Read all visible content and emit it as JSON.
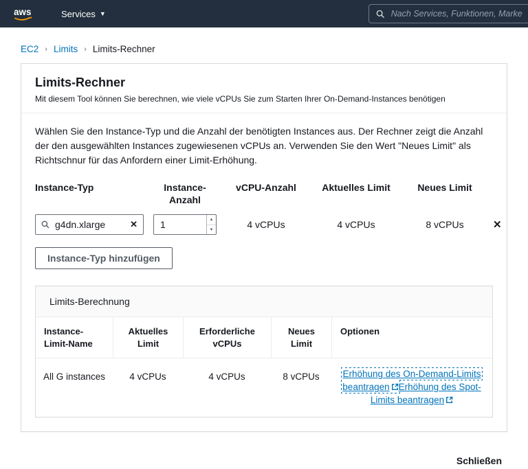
{
  "topbar": {
    "logo_text": "aws",
    "services_label": "Services",
    "search_placeholder": "Nach Services, Funktionen, Marketp"
  },
  "breadcrumb": {
    "items": [
      "EC2",
      "Limits",
      "Limits-Rechner"
    ],
    "separator": "›"
  },
  "card": {
    "title": "Limits-Rechner",
    "subtitle": "Mit diesem Tool können Sie berechnen, wie viele vCPUs Sie zum Starten Ihrer On-Demand-Instances benötigen",
    "description": "Wählen Sie den Instance-Typ und die Anzahl der benötigten Instances aus. Der Rechner zeigt die Anzahl der den ausgewählten Instances zugewiesenen vCPUs an. Verwenden Sie den Wert \"Neues Limit\" als Richtschnur für das Anfordern einer Limit-Erhöhung."
  },
  "calculator": {
    "headers": {
      "type": "Instance-Typ",
      "count": "Instance-Anzahl",
      "vcpus": "vCPU-Anzahl",
      "current": "Aktuelles Limit",
      "new": "Neues Limit"
    },
    "row": {
      "type_value": "g4dn.xlarge",
      "count_value": "1",
      "vcpus": "4 vCPUs",
      "current": "4 vCPUs",
      "new": "8 vCPUs",
      "clear_glyph": "✕",
      "remove_glyph": "✕"
    },
    "stepper": {
      "up": "▲",
      "down": "▼"
    },
    "add_button_label": "Instance-Typ hinzufügen"
  },
  "limits_table": {
    "title": "Limits-Berechnung",
    "headers": {
      "name": "Instance-Limit-Name",
      "current": "Aktuelles Limit",
      "required": "Erforderliche vCPUs",
      "new": "Neues Limit",
      "options": "Optionen"
    },
    "row": {
      "name": "All G instances",
      "current": "4 vCPUs",
      "required": "4 vCPUs",
      "new": "8 vCPUs",
      "link_on_demand": "Erhöhung des On-Demand-Limits beantragen",
      "link_spot": "Erhöhung des Spot-Limits beantragen"
    }
  },
  "footer": {
    "close_label": "Schließen"
  },
  "colors": {
    "navbar_bg": "#232f3e",
    "link": "#0073bb",
    "logo_accent": "#ff9900"
  }
}
